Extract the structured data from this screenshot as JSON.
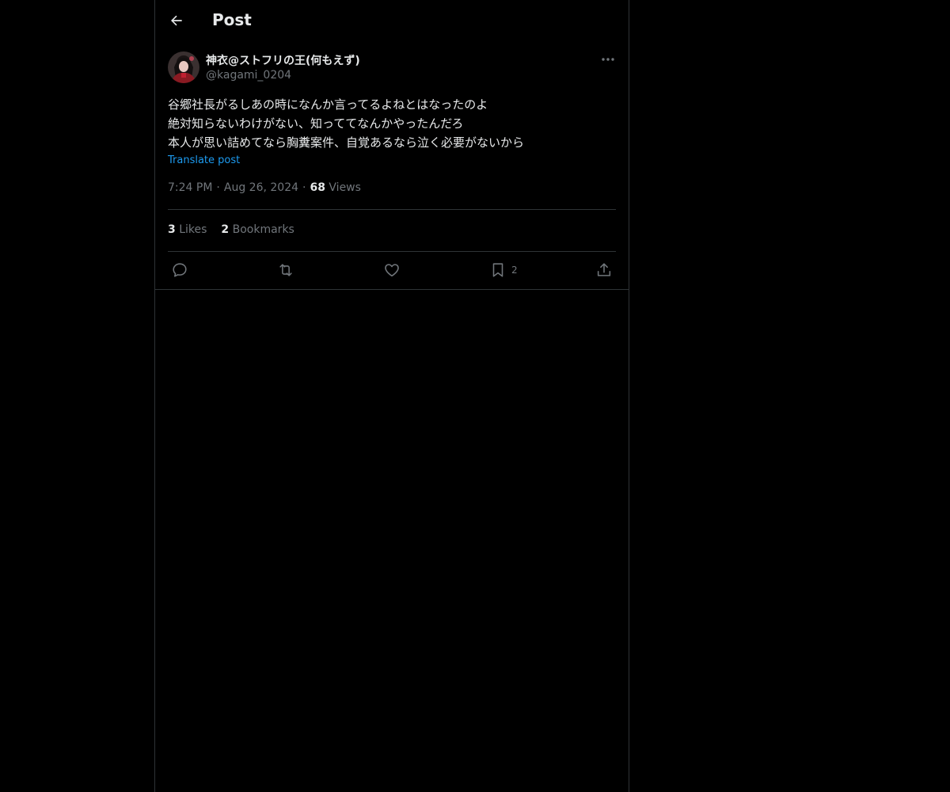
{
  "header": {
    "title": "Post",
    "back_icon": "arrow-left-icon"
  },
  "author": {
    "display_name": "神衣@ストフリの王(何もえず)",
    "handle": "@kagami_0204",
    "avatar_icon": "avatar-image"
  },
  "post": {
    "lines": [
      "谷郷社長がるしあの時になんか言ってるよねとはなったのよ",
      "絶対知らないわけがない、知っててなんかやったんだろ",
      "本人が思い詰めてなら胸糞案件、自覚あるなら泣く必要がないから"
    ],
    "translate_label": "Translate post",
    "time": "7:24 PM",
    "date": "Aug 26, 2024",
    "separator": "·",
    "views_count": "68",
    "views_label": "Views"
  },
  "stats": {
    "likes_count": "3",
    "likes_label": "Likes",
    "bookmarks_count": "2",
    "bookmarks_label": "Bookmarks"
  },
  "actions": {
    "reply_icon": "reply-icon",
    "repost_icon": "repost-icon",
    "like_icon": "heart-icon",
    "bookmark_icon": "bookmark-icon",
    "bookmark_count": "2",
    "share_icon": "share-icon",
    "more_icon": "more-dots-icon"
  },
  "colors": {
    "background": "#000000",
    "text_primary": "#e7e9ea",
    "text_secondary": "#71767b",
    "accent": "#1d9bf0",
    "border": "#2f3336"
  }
}
